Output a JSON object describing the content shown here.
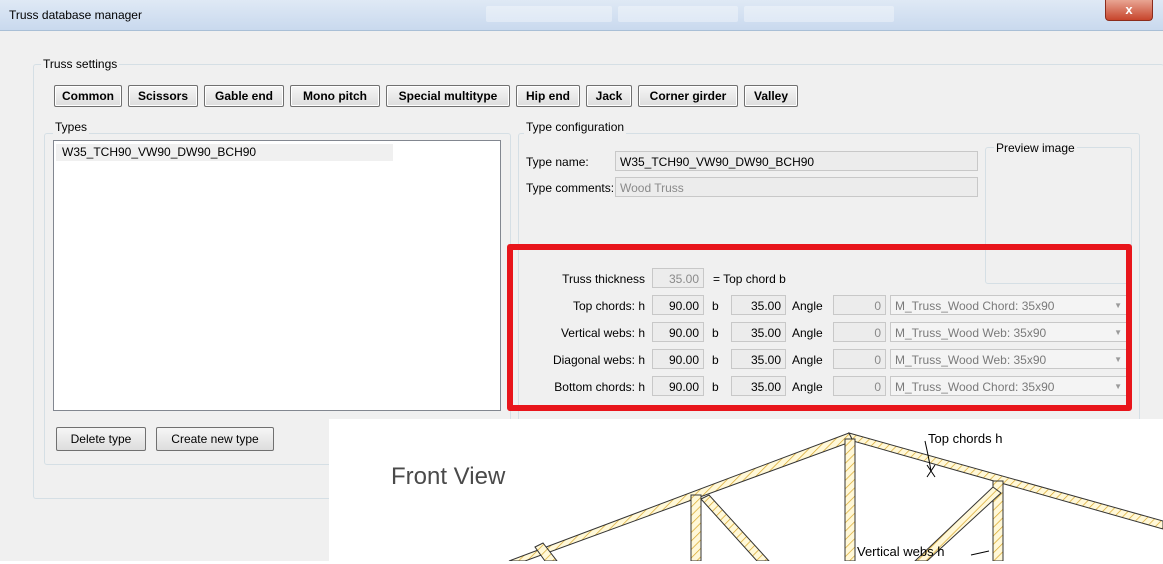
{
  "window": {
    "title": "Truss database manager",
    "close_label": "x"
  },
  "truss_settings": {
    "legend": "Truss settings",
    "type_buttons": [
      "Common",
      "Scissors",
      "Gable end",
      "Mono pitch",
      "Special multitype",
      "Hip end",
      "Jack",
      "Corner girder",
      "Valley"
    ]
  },
  "types": {
    "legend": "Types",
    "items": [
      "W35_TCH90_VW90_DW90_BCH90"
    ],
    "delete_label": "Delete type",
    "create_label": "Create new type"
  },
  "config": {
    "legend": "Type configuration",
    "name_label": "Type name:",
    "name_value": "W35_TCH90_VW90_DW90_BCH90",
    "comments_label": "Type comments:",
    "comments_value": "Wood Truss",
    "preview_legend": "Preview image",
    "thickness_label": "Truss thickness",
    "thickness_value": "35.00",
    "thickness_suffix": "= Top chord b",
    "rows": [
      {
        "label": "Top chords: h",
        "h": "90.00",
        "b_label": "b",
        "b": "35.00",
        "angle_label": "Angle",
        "angle": "0",
        "material": "M_Truss_Wood Chord: 35x90"
      },
      {
        "label": "Vertical webs: h",
        "h": "90.00",
        "b_label": "b",
        "b": "35.00",
        "angle_label": "Angle",
        "angle": "0",
        "material": "M_Truss_Wood Web: 35x90"
      },
      {
        "label": "Diagonal webs: h",
        "h": "90.00",
        "b_label": "b",
        "b": "35.00",
        "angle_label": "Angle",
        "angle": "0",
        "material": "M_Truss_Wood Web: 35x90"
      },
      {
        "label": "Bottom chords: h",
        "h": "90.00",
        "b_label": "b",
        "b": "35.00",
        "angle_label": "Angle",
        "angle": "0",
        "material": "M_Truss_Wood Chord: 35x90"
      }
    ]
  },
  "drawing": {
    "title": "Front View",
    "top_chords_label": "Top chords h",
    "vertical_webs_label": "Vertical webs h"
  },
  "colors": {
    "highlight": "#e8151b",
    "titlebar": "#c9d9ee",
    "timber": "#e8c85a"
  }
}
